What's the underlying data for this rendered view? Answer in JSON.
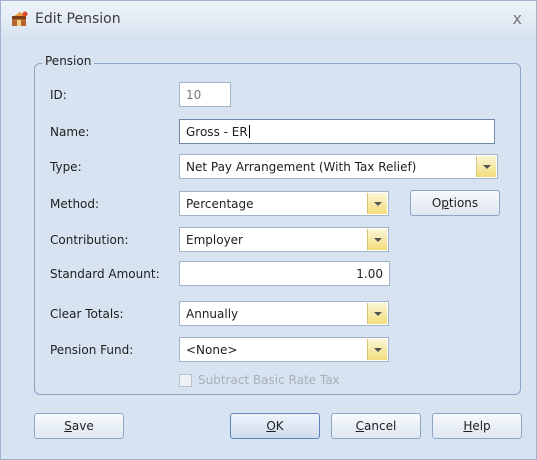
{
  "window": {
    "title": "Edit Pension",
    "close_label": "x"
  },
  "group": {
    "label": "Pension"
  },
  "fields": {
    "id": {
      "label": "ID:",
      "value": "10"
    },
    "name": {
      "label": "Name:",
      "value": "Gross - ER"
    },
    "type": {
      "label": "Type:",
      "value": "Net Pay Arrangement (With Tax Relief)"
    },
    "method": {
      "label": "Method:",
      "value": "Percentage"
    },
    "contribution": {
      "label": "Contribution:",
      "value": "Employer"
    },
    "standard_amount": {
      "label": "Standard Amount:",
      "value": "1.00"
    },
    "clear_totals": {
      "label": "Clear Totals:",
      "value": "Annually"
    },
    "pension_fund": {
      "label": "Pension Fund:",
      "value": "<None>"
    }
  },
  "options_button": {
    "pre": "O",
    "mnemonic": "p",
    "post": "tions"
  },
  "subtract_basic_rate_tax": {
    "label": "Subtract Basic Rate Tax",
    "checked": false,
    "enabled": false
  },
  "buttons": {
    "save": {
      "mnemonic": "S",
      "rest": "ave"
    },
    "ok": {
      "mnemonic": "O",
      "rest": "K"
    },
    "cancel": {
      "mnemonic": "C",
      "rest": "ancel"
    },
    "help": {
      "mnemonic": "H",
      "rest": "elp"
    }
  },
  "colors": {
    "dialog_bg": "#d7e3f1",
    "combo_arrow": "#f3dd7c",
    "border": "#8aa5c8"
  }
}
